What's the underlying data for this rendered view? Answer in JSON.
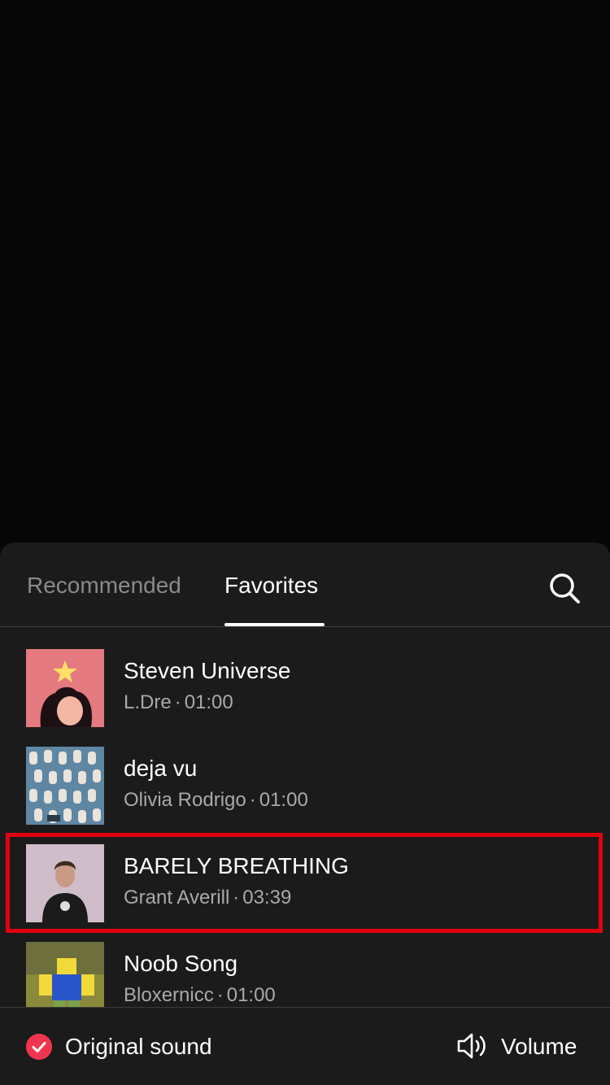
{
  "tabs": {
    "recommended": "Recommended",
    "favorites": "Favorites"
  },
  "songs": [
    {
      "title": "Steven Universe",
      "artist": "L.Dre",
      "duration": "01:00",
      "cover": "star-character-cover"
    },
    {
      "title": "deja vu",
      "artist": "Olivia Rodrigo",
      "duration": "01:00",
      "cover": "collage-cover"
    },
    {
      "title": "BARELY BREATHING",
      "artist": "Grant Averill",
      "duration": "03:39",
      "cover": "portrait-cover"
    },
    {
      "title": "Noob Song",
      "artist": "Bloxernicc",
      "duration": "01:00",
      "cover": "roblox-character-cover"
    }
  ],
  "separator": "·",
  "footer": {
    "original_sound": "Original sound",
    "volume": "Volume"
  },
  "icons": {
    "search": "search-icon",
    "check": "check-icon",
    "volume": "speaker-icon"
  },
  "colors": {
    "sheet_bg": "#1b1b1b",
    "accent": "#f0364e",
    "highlight": "#e1000f"
  }
}
